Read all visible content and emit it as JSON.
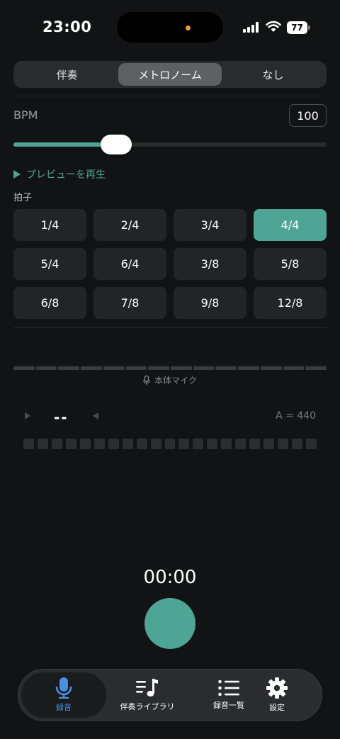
{
  "status_bar": {
    "time": "23:00",
    "battery": "77"
  },
  "accompaniment_mode": {
    "options": [
      "伴奏",
      "メトロノーム",
      "なし"
    ],
    "selected": "メトロノーム"
  },
  "bpm": {
    "label": "BPM",
    "value": "100",
    "slider_fraction": 0.31
  },
  "preview": {
    "label": "プレビューを再生"
  },
  "time_signature": {
    "label": "拍子",
    "options": [
      "1/4",
      "2/4",
      "3/4",
      "4/4",
      "5/4",
      "6/4",
      "3/8",
      "5/8",
      "6/8",
      "7/8",
      "9/8",
      "12/8"
    ],
    "selected": "4/4"
  },
  "input": {
    "mic_label": "本体マイク"
  },
  "tuner": {
    "note": "--",
    "reference": "A = 440"
  },
  "recorder": {
    "timer": "00:00"
  },
  "colors": {
    "accent": "#4fa595",
    "active_tab": "#4a90e2"
  },
  "tab_bar": {
    "tabs": [
      {
        "label": "録音",
        "icon": "microphone-icon",
        "active": true
      },
      {
        "label": "伴奏ライブラリ",
        "icon": "music-list-icon",
        "active": false
      },
      {
        "label": "録音一覧",
        "icon": "list-icon",
        "active": false
      },
      {
        "label": "設定",
        "icon": "gear-icon",
        "active": false
      }
    ]
  }
}
